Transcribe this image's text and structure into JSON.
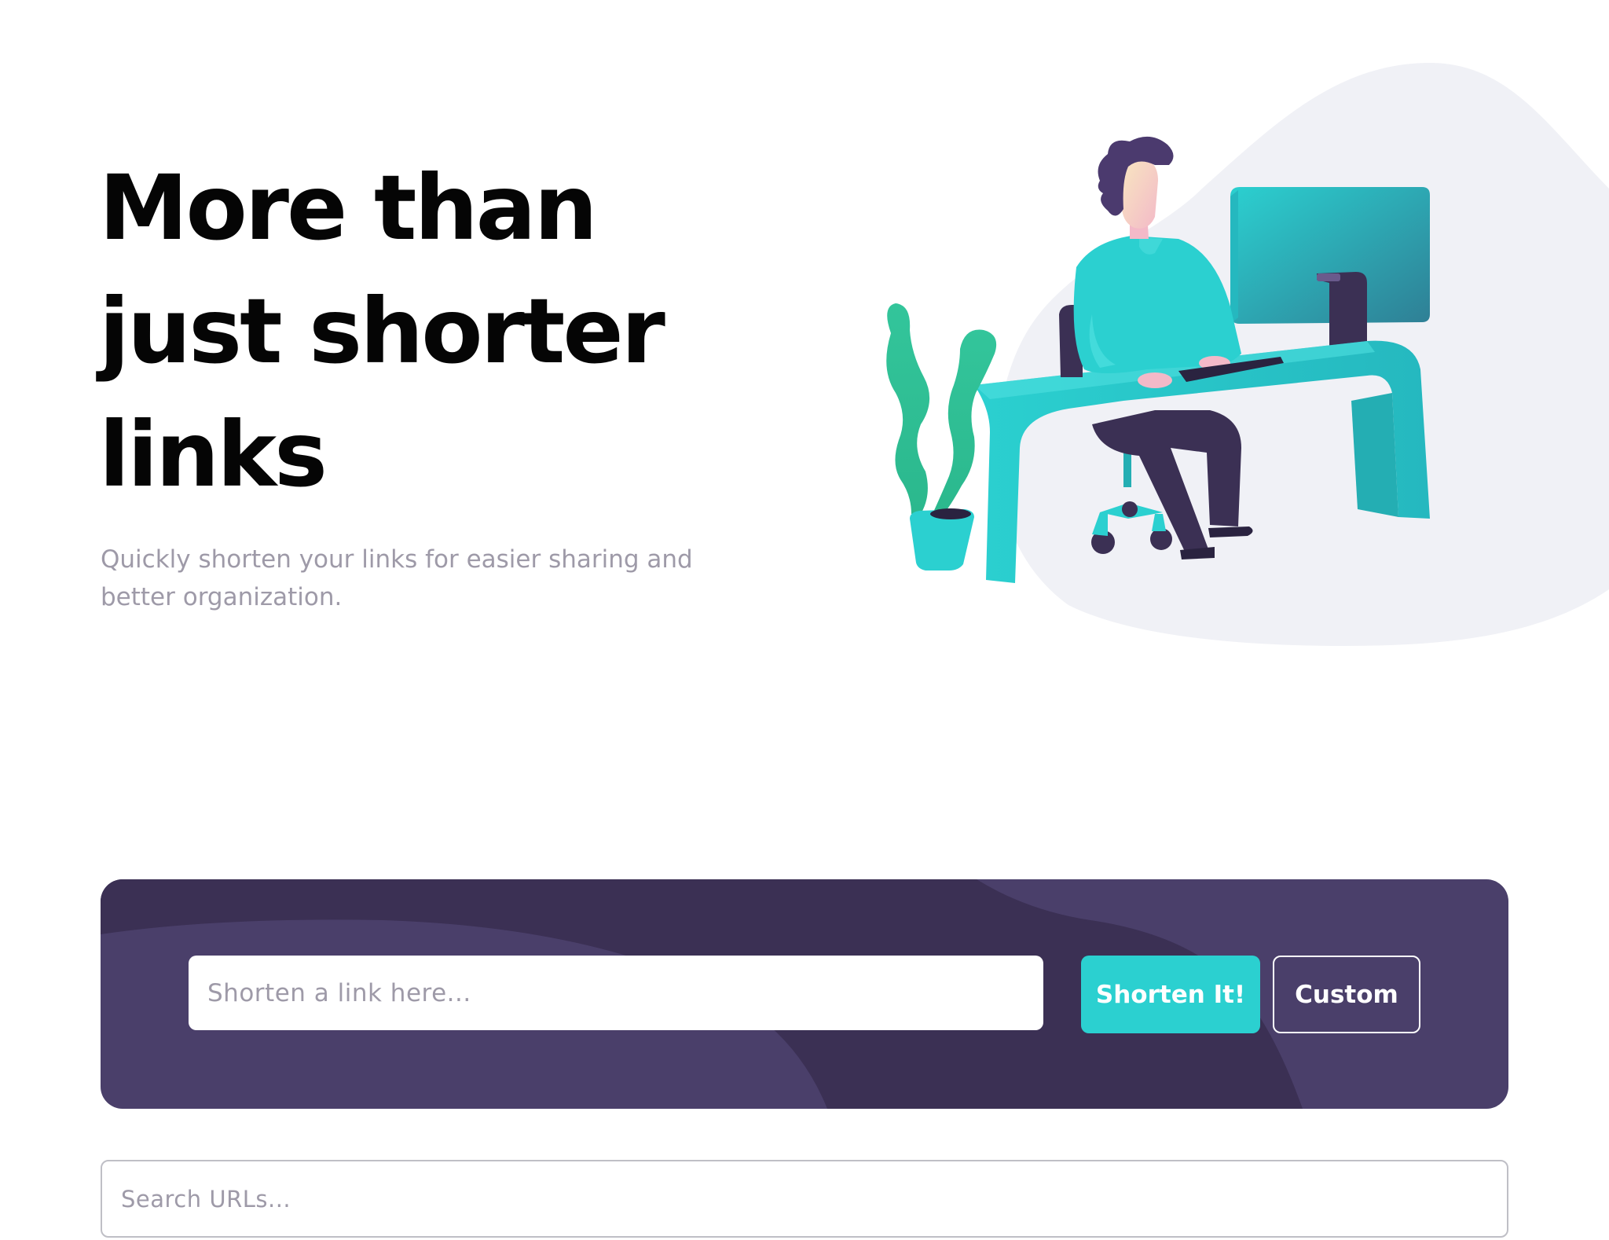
{
  "hero": {
    "title_lines": [
      "More than",
      "just shorter",
      "links"
    ],
    "subtitle_line1": "Quickly shorten your links for easier sharing and",
    "subtitle_line2": "better organization.",
    "illustration": "person-working-at-desk-illustration"
  },
  "shorten": {
    "placeholder": "Shorten a link here...",
    "value": "",
    "shorten_label": "Shorten It!",
    "custom_label": "Custom"
  },
  "search": {
    "placeholder": "Search URLs...",
    "value": ""
  },
  "colors": {
    "primary_cyan": "#2bd0d0",
    "dark_violet": "#3b3054",
    "panel_violet": "#4a3f6a",
    "heading_text": "#050505",
    "muted_text": "#9e9aa8",
    "illustration_blob": "#f0f1f6"
  }
}
